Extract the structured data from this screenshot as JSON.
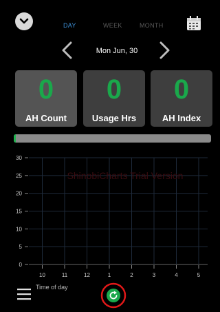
{
  "tabs": {
    "day": "DAY",
    "week": "WEEK",
    "month": "MONTH"
  },
  "date": {
    "label": "Mon Jun, 30"
  },
  "stats": [
    {
      "value": "0",
      "label": "AH Count"
    },
    {
      "value": "0",
      "label": "Usage Hrs"
    },
    {
      "value": "0",
      "label": "AH Index"
    }
  ],
  "progress": {
    "fraction": 0.01
  },
  "chart_data": {
    "type": "bar",
    "categories": [
      "10",
      "11",
      "12",
      "1",
      "2",
      "3",
      "4",
      "5"
    ],
    "values": [
      0,
      0,
      0,
      0,
      0,
      0,
      0,
      0
    ],
    "ylim": [
      0,
      30
    ],
    "yticks": [
      "0",
      "5",
      "10",
      "15",
      "20",
      "25",
      "30"
    ],
    "xlabel": "Time of day",
    "watermark": "ShinobiCharts Trial Version",
    "grid": true
  },
  "colors": {
    "accent_green": "#1aa84b",
    "tab_active": "#3d8fd6",
    "tab_inactive": "#5a5a5a",
    "grid": "#1e2a3a",
    "highlight_ring": "#e01818"
  },
  "icons": {
    "collapse": "chevron-down-icon",
    "calendar": "calendar-icon",
    "prev": "chevron-left-icon",
    "next": "chevron-right-icon",
    "menu": "hamburger-icon",
    "refresh": "refresh-icon"
  }
}
